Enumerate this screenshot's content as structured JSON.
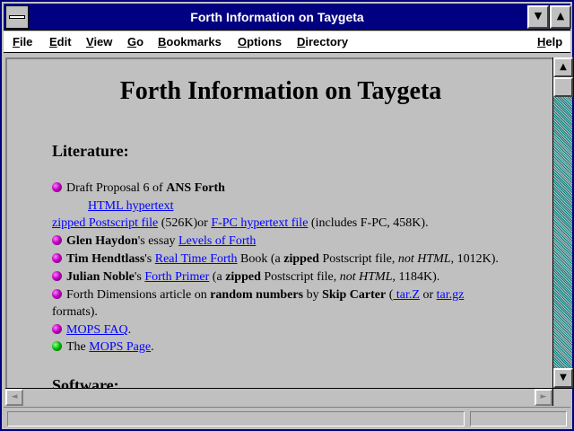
{
  "window": {
    "title": "Forth Information on Taygeta",
    "minimize_glyph": "▼",
    "maximize_glyph": "▲"
  },
  "menu": {
    "items": [
      "File",
      "Edit",
      "View",
      "Go",
      "Bookmarks",
      "Options",
      "Directory",
      "Help"
    ]
  },
  "page": {
    "heading": "Forth Information on Taygeta",
    "literature_heading": "Literature:",
    "software_heading": "Software:",
    "items": {
      "ans": {
        "pre": "Draft Proposal 6 of ",
        "bold": "ANS Forth",
        "link_html": "HTML hypertext",
        "link_ps": "zipped Postscript file",
        "ps_size": " (526K)or ",
        "link_fpc": "F-PC hypertext file",
        "fpc_note": " (includes F-PC, 458K)."
      },
      "haydon": {
        "bold": "Glen Haydon",
        "mid": "'s essay ",
        "link": "Levels of Forth"
      },
      "hendtlass": {
        "bold": "Tim Hendtlass",
        "mid": "'s ",
        "link": "Real Time Forth",
        "after1": " Book (a ",
        "bold2": "zipped",
        "after2": " Postscript file, ",
        "italic": "not HTML",
        "after3": ", 1012K)."
      },
      "noble": {
        "bold": "Julian Noble",
        "mid": "'s ",
        "link": "Forth Primer",
        "after1": " (a ",
        "bold2": "zipped",
        "after2": " Postscript file, ",
        "italic": "not HTML",
        "after3": ", 1184K)."
      },
      "fd": {
        "pre": "Forth Dimensions article on ",
        "bold": "random numbers",
        "mid": " by ",
        "bold2": "Skip Carter",
        "paren": " (",
        "link1": " tar.Z",
        "or": " or ",
        "link2": "tar.gz",
        "cont": "formats)."
      },
      "mops_faq": {
        "link": "MOPS FAQ",
        "after": "."
      },
      "mops_page": {
        "pre": "The ",
        "link": "MOPS Page",
        "after": "."
      }
    }
  },
  "scroll": {
    "up_glyph": "▲",
    "down_glyph": "▼",
    "left_glyph": "◄",
    "right_glyph": "►"
  },
  "status": {
    "text": ""
  }
}
